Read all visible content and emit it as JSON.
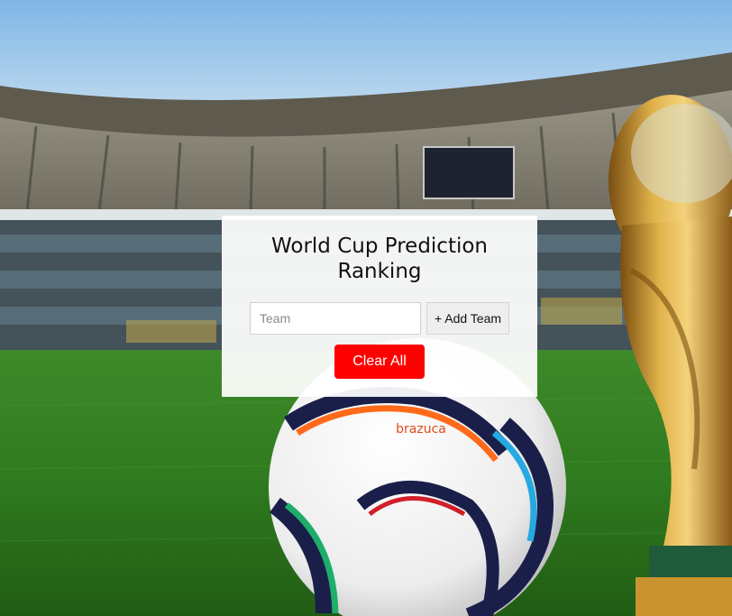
{
  "page": {
    "title": "World Cup Prediction Ranking"
  },
  "form": {
    "team_placeholder": "Team",
    "team_value": "",
    "add_label": "+ Add Team",
    "clear_label": "Clear All"
  },
  "background": {
    "ball_brand": "brazuca",
    "scene_icons": [
      "stadium-background",
      "soccer-ball-icon",
      "world-cup-trophy-icon"
    ]
  },
  "colors": {
    "clear_button": "#ff0000",
    "card": "#ffffff",
    "add_button": "#eeeeee"
  }
}
